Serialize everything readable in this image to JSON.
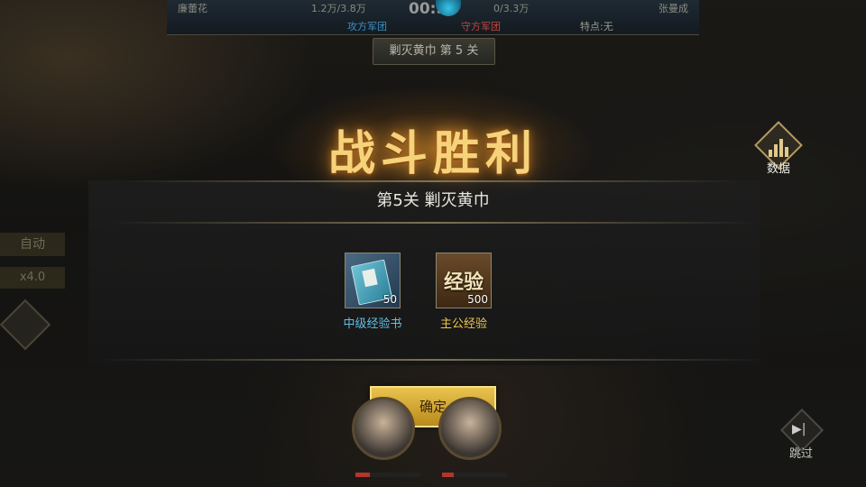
{
  "hud": {
    "attacker_name": "廉蕾花",
    "attacker_troops": "1.2万/3.8万",
    "attacker_label": "攻方军团",
    "timer": "00:5",
    "defender_troops": "0/3.3万",
    "defender_name": "张曼成",
    "defender_label": "守方军团",
    "trait": "特点:无",
    "stage_tab": "剿灭黄巾  第 5 关"
  },
  "controls": {
    "auto_label": "自动",
    "speed_label": "x4.0"
  },
  "victory": {
    "title": "战斗胜利",
    "subtitle": "第5关 剿灭黄巾"
  },
  "rewards": [
    {
      "name": "中级经验书",
      "count": "50",
      "icon": "book-icon"
    },
    {
      "name": "主公经验",
      "count": "500",
      "icon": "exp-icon",
      "icon_text": "经验"
    }
  ],
  "data_button": {
    "label": "数据",
    "icon": "bar-chart-icon"
  },
  "confirm_button": {
    "label": "确定"
  },
  "skip_button": {
    "label": "跳过",
    "icon": "skip-icon"
  },
  "colors": {
    "title_gold": "#f6d27a",
    "reward_book_name": "#5fc0ea",
    "reward_exp_name": "#f0c44c",
    "confirm_bg": "#e9c44e",
    "attacker_blue": "#3d8fc4",
    "defender_red": "#c0463f"
  }
}
